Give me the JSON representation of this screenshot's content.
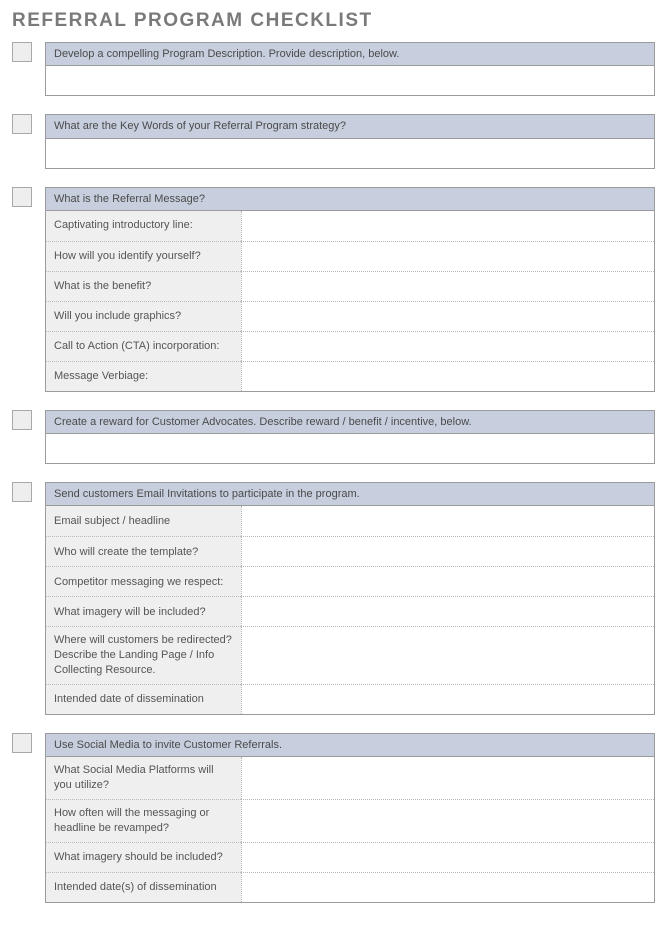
{
  "title": "REFERRAL PROGRAM CHECKLIST",
  "sections": [
    {
      "header": "Develop a compelling Program Description.  Provide description, below.",
      "type": "blank"
    },
    {
      "header": "What are the Key Words of your Referral Program strategy?",
      "type": "blank"
    },
    {
      "header": "What is the Referral Message?",
      "type": "rows",
      "rows": [
        "Captivating introductory line:",
        "How will you identify yourself?",
        "What is the benefit?",
        "Will you include graphics?",
        "Call to Action (CTA) incorporation:",
        "Message Verbiage:"
      ]
    },
    {
      "header": "Create a reward for Customer Advocates.  Describe reward / benefit / incentive, below.",
      "type": "blank"
    },
    {
      "header": "Send customers Email Invitations to participate in the program.",
      "type": "rows",
      "rows": [
        "Email subject / headline",
        "Who will create the template?",
        "Competitor messaging we respect:",
        "What imagery will be included?",
        "Where will customers be redirected? Describe the Landing Page / Info Collecting Resource.",
        "Intended date of dissemination"
      ]
    },
    {
      "header": "Use Social Media to invite Customer Referrals.",
      "type": "rows",
      "rows": [
        "What Social Media Platforms will you utilize?",
        "How often will the messaging or headline be revamped?",
        "What imagery should be included?",
        "Intended date(s) of dissemination"
      ]
    }
  ]
}
